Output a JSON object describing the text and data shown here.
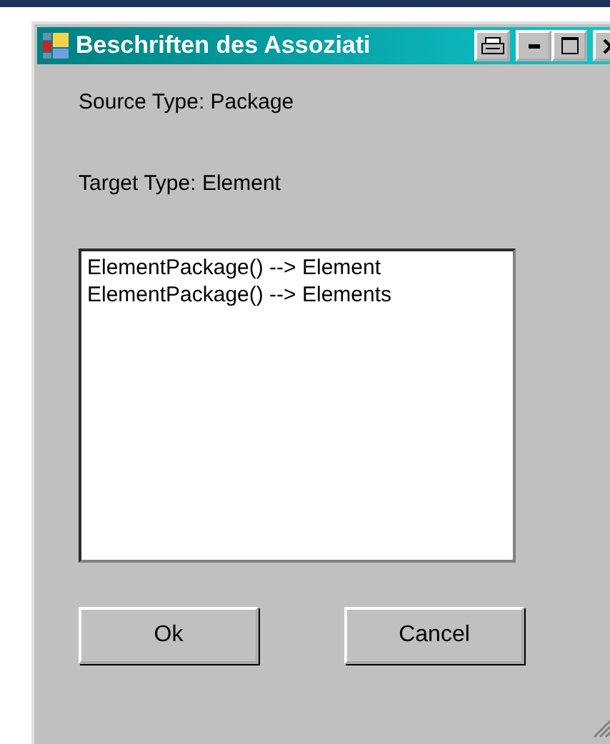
{
  "window": {
    "title": "Beschriften des Assoziati"
  },
  "source_type": "Source Type: Package",
  "target_type": "Target Type: Element",
  "list": {
    "items": [
      {
        "label": "ElementPackage() --> Element",
        "selected": false
      },
      {
        "label": "ElementPackage() --> Elements",
        "selected": false
      }
    ]
  },
  "buttons": [
    "Ok",
    "Cancel"
  ]
}
